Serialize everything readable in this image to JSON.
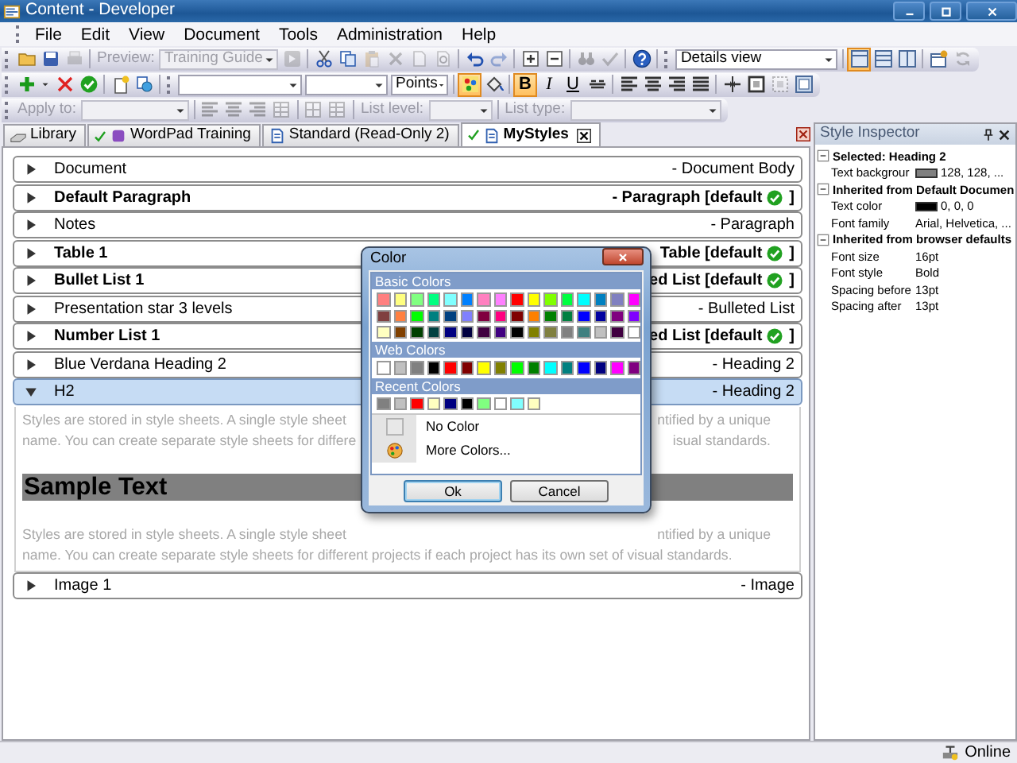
{
  "window": {
    "title": "Content - Developer"
  },
  "menu": [
    "File",
    "Edit",
    "View",
    "Document",
    "Tools",
    "Administration",
    "Help"
  ],
  "toolbars": [
    {
      "groups": [
        [
          {
            "kind": "button",
            "disabled": false
          },
          {
            "kind": "button",
            "disabled": false
          },
          {
            "kind": "button",
            "disabled": true
          }
        ],
        [
          {
            "kind": "label",
            "text": "Preview:",
            "disabled": true
          },
          {
            "kind": "select",
            "value": "Training Guide",
            "disabled": true
          },
          {
            "kind": "button",
            "disabled": true
          }
        ],
        [
          {
            "kind": "button",
            "disabled": false
          },
          {
            "kind": "button",
            "disabled": false
          },
          {
            "kind": "button",
            "disabled": true
          },
          {
            "kind": "button",
            "disabled": true
          },
          {
            "kind": "button",
            "disabled": true
          },
          {
            "kind": "button",
            "disabled": true
          }
        ],
        [
          {
            "kind": "button",
            "disabled": false
          },
          {
            "kind": "button",
            "disabled": true
          }
        ],
        [
          {
            "kind": "button",
            "disabled": false
          },
          {
            "kind": "button",
            "disabled": false
          }
        ],
        [
          {
            "kind": "button",
            "disabled": true
          },
          {
            "kind": "button",
            "disabled": true
          }
        ],
        [
          {
            "kind": "button",
            "disabled": false
          }
        ],
        [
          {
            "kind": "grip"
          },
          {
            "kind": "select",
            "value": "Details view",
            "disabled": false
          }
        ],
        [
          {
            "kind": "button",
            "selected": true,
            "disabled": false
          },
          {
            "kind": "button",
            "selected": false,
            "disabled": false
          },
          {
            "kind": "button",
            "selected": false,
            "disabled": false
          }
        ],
        [
          {
            "kind": "button",
            "disabled": false
          },
          {
            "kind": "button",
            "disabled": true
          }
        ]
      ]
    },
    {
      "groups": [
        [
          {
            "kind": "button",
            "disabled": false
          },
          {
            "kind": "caret"
          },
          {
            "kind": "button",
            "disabled": false
          },
          {
            "kind": "button",
            "disabled": false
          }
        ],
        [
          {
            "kind": "button",
            "disabled": false
          },
          {
            "kind": "button",
            "disabled": false
          }
        ],
        [
          {
            "kind": "grip"
          },
          {
            "kind": "select",
            "disabled": false
          },
          {
            "kind": "select",
            "disabled": false
          },
          {
            "kind": "select",
            "value": "Points",
            "disabled": false
          }
        ],
        [
          {
            "kind": "button",
            "selected": true,
            "disabled": false
          },
          {
            "kind": "button",
            "disabled": false
          }
        ],
        [
          {
            "kind": "text-button",
            "text": "B",
            "selected": true,
            "disabled": false
          },
          {
            "kind": "text-button",
            "text": "I",
            "selected": false,
            "disabled": false
          },
          {
            "kind": "text-button",
            "text": "U",
            "selected": false,
            "disabled": false
          },
          {
            "kind": "button",
            "selected": false,
            "disabled": false
          }
        ],
        [
          {
            "kind": "button",
            "selected": false,
            "disabled": false
          },
          {
            "kind": "button",
            "selected": false,
            "disabled": false
          },
          {
            "kind": "button",
            "selected": false,
            "disabled": false
          },
          {
            "kind": "button",
            "selected": false,
            "disabled": false
          }
        ],
        [
          {
            "kind": "button",
            "disabled": false
          },
          {
            "kind": "button",
            "disabled": false
          },
          {
            "kind": "button",
            "disabled": true
          },
          {
            "kind": "button",
            "disabled": false
          }
        ]
      ]
    },
    {
      "groups": [
        [
          {
            "kind": "label",
            "text": "Apply to:",
            "disabled": true
          },
          {
            "kind": "select",
            "disabled": true
          }
        ],
        [
          {
            "kind": "button",
            "disabled": true
          },
          {
            "kind": "button",
            "disabled": true
          },
          {
            "kind": "button",
            "disabled": true
          },
          {
            "kind": "button",
            "disabled": true
          }
        ],
        [
          {
            "kind": "button",
            "disabled": true
          },
          {
            "kind": "button",
            "disabled": true
          }
        ],
        [
          {
            "kind": "label",
            "text": "List level:",
            "disabled": true
          },
          {
            "kind": "select",
            "disabled": true
          }
        ],
        [
          {
            "kind": "label",
            "text": "List type:",
            "disabled": true
          },
          {
            "kind": "select",
            "disabled": true
          }
        ]
      ]
    }
  ],
  "tabs": [
    {
      "label": "Library",
      "selected": false,
      "checked": false
    },
    {
      "label": "WordPad Training",
      "selected": false,
      "checked": true
    },
    {
      "label": "Standard (Read-Only 2)",
      "selected": false,
      "checked": false
    },
    {
      "label": "MyStyles",
      "selected": true,
      "checked": true
    }
  ],
  "styles": [
    {
      "name": "Document",
      "description": "- Document Body",
      "default": false,
      "expanded": false,
      "selected": false
    },
    {
      "name": "Default Paragraph",
      "description": "- Paragraph [default",
      "suffix": "]",
      "default": true,
      "expanded": false,
      "selected": false
    },
    {
      "name": "Notes",
      "description": "- Paragraph",
      "default": false,
      "expanded": false,
      "selected": false
    },
    {
      "name": "Table 1",
      "description": "Table [default",
      "suffix": "]",
      "default": true,
      "expanded": false,
      "selected": false
    },
    {
      "name": "Bullet List 1",
      "description": "ed List [default",
      "suffix": "]",
      "default": true,
      "expanded": false,
      "selected": false
    },
    {
      "name": "Presentation star 3 levels",
      "description": "- Bulleted List",
      "default": false,
      "expanded": false,
      "selected": false
    },
    {
      "name": "Number List 1",
      "description": "ed List [default",
      "suffix": "]",
      "default": true,
      "expanded": false,
      "selected": false
    },
    {
      "name": "Blue Verdana Heading 2",
      "description": "- Heading 2",
      "default": false,
      "expanded": false,
      "selected": false
    },
    {
      "name": "H2",
      "description": "- Heading 2",
      "default": false,
      "expanded": true,
      "selected": true,
      "preview": [
        {
          "kind": "paragraph",
          "lines": [
            {
              "left": "Styles are stored in style sheets. A single style sheet",
              "right": "ntified by a unique"
            },
            {
              "left": "name. You can create separate style sheets for differe",
              "right": "isual standards."
            }
          ]
        },
        {
          "kind": "heading",
          "text": "Sample Text"
        },
        {
          "kind": "paragraph",
          "lines": [
            {
              "left": "Styles are stored in style sheets. A single style sheet",
              "right": "ntified by a unique"
            },
            {
              "left": "name. You can create separate style sheets for different projects if each project has its own set of visual standards."
            }
          ]
        }
      ]
    },
    {
      "name": "Image 1",
      "description": "- Image",
      "default": false,
      "expanded": false,
      "selected": false
    }
  ],
  "inspector": {
    "title": "Style Inspector",
    "groups": [
      {
        "title": "Selected: Heading 2",
        "expanded": true,
        "properties": [
          {
            "label": "Text backgrour",
            "value": "128, 128, ...",
            "color": "#808080"
          }
        ]
      },
      {
        "title": "Inherited from Default Documen",
        "expanded": true,
        "properties": [
          {
            "label": "Text color",
            "value": "0, 0, 0",
            "color": "#000000"
          },
          {
            "label": "Font family",
            "value": "Arial, Helvetica, ..."
          }
        ]
      },
      {
        "title": "Inherited from browser defaults",
        "expanded": true,
        "properties": [
          {
            "label": "Font size",
            "value": "16pt"
          },
          {
            "label": "Font style",
            "value": "Bold"
          },
          {
            "label": "Spacing before",
            "value": "13pt"
          },
          {
            "label": "Spacing after",
            "value": "13pt"
          }
        ]
      }
    ]
  },
  "color_dialog": {
    "title": "Color",
    "sections": [
      {
        "title": "Basic Colors",
        "colors": [
          {
            "color": "#ff8080"
          },
          {
            "color": "#ffff80"
          },
          {
            "color": "#80ff80"
          },
          {
            "color": "#00ff80"
          },
          {
            "color": "#80ffff"
          },
          {
            "color": "#0080ff"
          },
          {
            "color": "#ff80c0"
          },
          {
            "color": "#ff80ff"
          },
          {
            "color": "#ff0000"
          },
          {
            "color": "#ffff00"
          },
          {
            "color": "#80ff00"
          },
          {
            "color": "#00ff40"
          },
          {
            "color": "#00ffff"
          },
          {
            "color": "#0080c0"
          },
          {
            "color": "#8080c0"
          },
          {
            "color": "#ff00ff"
          },
          {
            "color": "#804040"
          },
          {
            "color": "#ff8040"
          },
          {
            "color": "#00ff00"
          },
          {
            "color": "#008080"
          },
          {
            "color": "#004080"
          },
          {
            "color": "#8080ff"
          },
          {
            "color": "#800040"
          },
          {
            "color": "#ff0080"
          },
          {
            "color": "#800000"
          },
          {
            "color": "#ff8000"
          },
          {
            "color": "#008000"
          },
          {
            "color": "#008040"
          },
          {
            "color": "#0000ff"
          },
          {
            "color": "#0000a0"
          },
          {
            "color": "#800080"
          },
          {
            "color": "#8000ff"
          },
          {
            "color": "#ffffc0"
          },
          {
            "color": "#804000"
          },
          {
            "color": "#004000"
          },
          {
            "color": "#004040"
          },
          {
            "color": "#000080"
          },
          {
            "color": "#000040"
          },
          {
            "color": "#400040"
          },
          {
            "color": "#400080"
          },
          {
            "color": "#000000"
          },
          {
            "color": "#808000"
          },
          {
            "color": "#808040"
          },
          {
            "color": "#808080"
          },
          {
            "color": "#408080"
          },
          {
            "color": "#c0c0c0"
          },
          {
            "color": "#400040"
          },
          {
            "color": "#ffffff"
          }
        ]
      },
      {
        "title": "Web Colors",
        "colors": [
          {
            "color": "#ffffff"
          },
          {
            "color": "#c0c0c0"
          },
          {
            "color": "#808080"
          },
          {
            "color": "#000000"
          },
          {
            "color": "#ff0000"
          },
          {
            "color": "#800000"
          },
          {
            "color": "#ffff00"
          },
          {
            "color": "#808000"
          },
          {
            "color": "#00ff00"
          },
          {
            "color": "#008000"
          },
          {
            "color": "#00ffff"
          },
          {
            "color": "#008080"
          },
          {
            "color": "#0000ff"
          },
          {
            "color": "#000080"
          },
          {
            "color": "#ff00ff"
          },
          {
            "color": "#800080"
          }
        ]
      },
      {
        "title": "Recent Colors",
        "colors": [
          {
            "color": "#808080"
          },
          {
            "color": "#c0c0c0"
          },
          {
            "color": "#ff0000"
          },
          {
            "color": "#ffffc0"
          },
          {
            "color": "#000080"
          },
          {
            "color": "#000000"
          },
          {
            "color": "#80ff80"
          },
          {
            "color": "#ffffff"
          },
          {
            "color": "#80ffff"
          },
          {
            "color": "#ffffc0"
          }
        ]
      }
    ],
    "options": [
      {
        "kind": "none",
        "label": "No Color"
      },
      {
        "kind": "more",
        "label": "More Colors..."
      }
    ],
    "buttons": [
      "Ok",
      "Cancel"
    ]
  },
  "status_bar": {
    "text": "Online"
  }
}
